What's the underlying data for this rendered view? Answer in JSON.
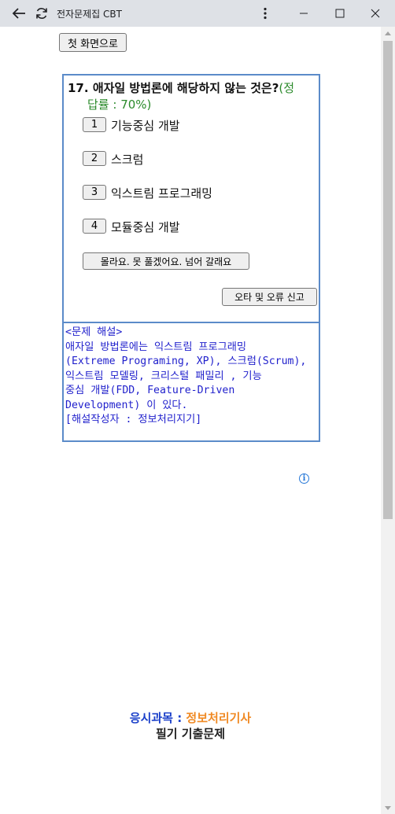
{
  "window": {
    "title": "전자문제집 CBT"
  },
  "page": {
    "home_button": "첫 화면으로",
    "question": {
      "number": "17.",
      "text": "애자일 방법론에 해당하지 않는 것은?",
      "rate_open": "(정",
      "rate_rest": "답률 : 70%)",
      "options": [
        {
          "num": "1",
          "label": "기능중심 개발"
        },
        {
          "num": "2",
          "label": "스크럼"
        },
        {
          "num": "3",
          "label": "익스트림 프로그래밍"
        },
        {
          "num": "4",
          "label": "모듈중심 개발"
        }
      ],
      "skip_button": "몰라요. 못 풀겠어요. 넘어 갈래요",
      "report_button": "오타 및 오류 신고"
    },
    "explanation": {
      "heading": "<문제 해설>",
      "lines": [
        "애자일 방법론에는 익스트림 프로그래밍",
        "(Extreme Programing, XP), 스크럼(Scrum),",
        "익스트림 모델링, 크리스털 패밀리 , 기능",
        "중심 개발(FDD, Feature-Driven",
        "Development) 이 있다.",
        "[해설작성자 : 정보처리지기]"
      ]
    },
    "footer": {
      "subject_label": "응시과목 : ",
      "subject_value": "정보처리기사",
      "exam_type": "필기 기출문제"
    }
  }
}
